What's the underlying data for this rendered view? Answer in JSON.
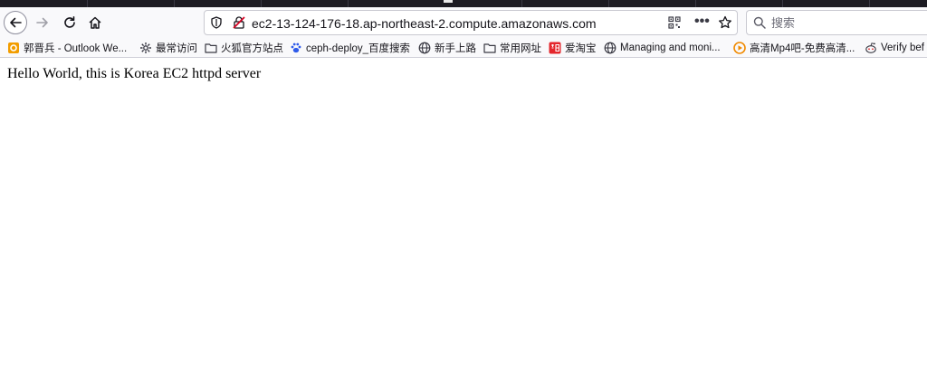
{
  "browser": {
    "url": "ec2-13-124-176-18.ap-northeast-2.compute.amazonaws.com",
    "search_placeholder": "搜索",
    "url_more_label": "•••"
  },
  "bookmarks": [
    {
      "label": "郭晋兵 - Outlook We...",
      "icon": "outlook-icon"
    },
    {
      "label": "最常访问",
      "icon": "gear-icon"
    },
    {
      "label": "火狐官方站点",
      "icon": "folder-icon"
    },
    {
      "label": "ceph-deploy_百度搜索",
      "icon": "baidu-paw-icon"
    },
    {
      "label": "新手上路",
      "icon": "globe-icon"
    },
    {
      "label": "常用网址",
      "icon": "folder-icon"
    },
    {
      "label": "爱淘宝",
      "icon": "taobao-icon"
    },
    {
      "label": "Managing and moni...",
      "icon": "globe-icon"
    },
    {
      "label": "高清Mp4吧-免费高清...",
      "icon": "mp4-play-icon"
    },
    {
      "label": "Verify bef",
      "icon": "reddit-icon"
    }
  ],
  "page": {
    "text": "Hello World, this is Korea EC2 httpd server"
  },
  "colors": {
    "toolbar_bg": "#f9f9fb",
    "tabstrip_bg": "#1c1b22",
    "insecure_red": "#d70022"
  }
}
